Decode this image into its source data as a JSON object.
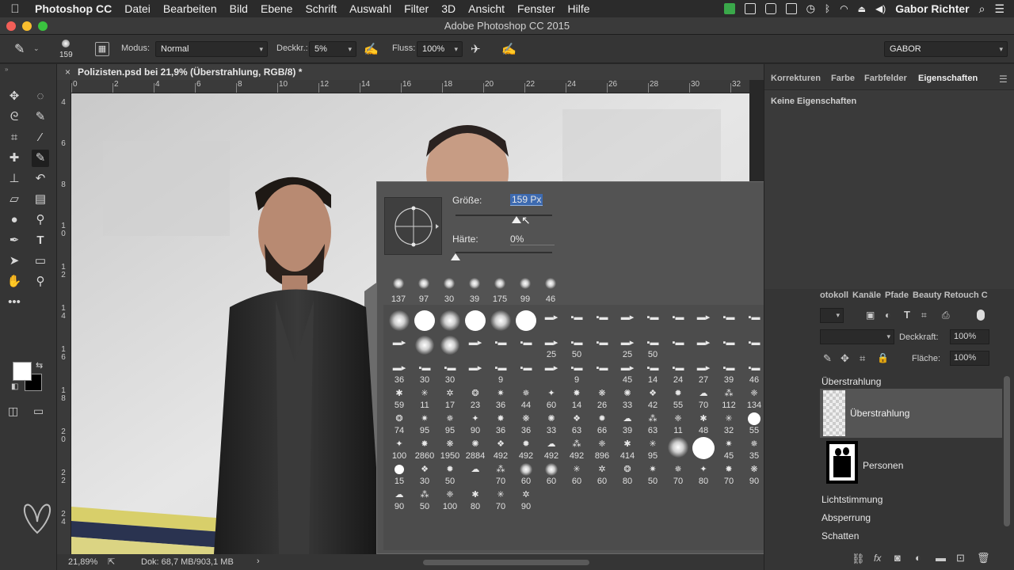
{
  "menubar": {
    "app_name": "Photoshop CC",
    "items": [
      "Datei",
      "Bearbeiten",
      "Bild",
      "Ebene",
      "Schrift",
      "Auswahl",
      "Filter",
      "3D",
      "Ansicht",
      "Fenster",
      "Hilfe"
    ],
    "user": "Gabor Richter"
  },
  "window": {
    "title": "Adobe Photoshop CC 2015"
  },
  "options": {
    "brush_size": "159",
    "mode_label": "Modus:",
    "mode_value": "Normal",
    "opacity_label": "Deckkr.:",
    "opacity_value": "5%",
    "flow_label": "Fluss:",
    "flow_value": "100%",
    "workspace": "GABOR"
  },
  "document": {
    "tab_title": "Polizisten.psd bei 21,9% (Überstrahlung, RGB/8) *",
    "close_glyph": "×"
  },
  "ruler": {
    "h_ticks": [
      "0",
      "2",
      "4",
      "6",
      "8",
      "10",
      "12",
      "14",
      "16",
      "18",
      "20",
      "22",
      "24",
      "26",
      "28",
      "30",
      "32"
    ],
    "v_ticks": [
      "4",
      "6",
      "8",
      "1 0",
      "1 2",
      "1 4",
      "1 6",
      "1 8",
      "2 0",
      "2 2",
      "2 4"
    ]
  },
  "status": {
    "zoom": "21,89%",
    "doc_info": "Dok: 68,7 MB/903,1 MB",
    "arrow": "›"
  },
  "picker": {
    "size_label": "Größe:",
    "size_value": "159 Px",
    "hardness_label": "Härte:",
    "hardness_value": "0%",
    "size_fraction": 0.63,
    "hardness_fraction": 0.0,
    "recent": [
      "137",
      "97",
      "30",
      "39",
      "175",
      "99",
      "46"
    ],
    "rows": [
      [
        "",
        "",
        "",
        "",
        "",
        "",
        "",
        "",
        "",
        "",
        "",
        "",
        "",
        "",
        ""
      ],
      [
        "",
        "",
        "",
        "",
        "",
        "",
        "25",
        "50",
        "",
        "25",
        "50",
        "",
        "",
        "",
        ""
      ],
      [
        "36",
        "30",
        "30",
        "",
        "9",
        "",
        "",
        "9",
        "",
        "45",
        "14",
        "24",
        "27",
        "39",
        "46"
      ],
      [
        "59",
        "11",
        "17",
        "23",
        "36",
        "44",
        "60",
        "14",
        "26",
        "33",
        "42",
        "55",
        "70",
        "112",
        "134"
      ],
      [
        "74",
        "95",
        "95",
        "90",
        "36",
        "36",
        "33",
        "63",
        "66",
        "39",
        "63",
        "11",
        "48",
        "32",
        "55"
      ],
      [
        "100",
        "2860",
        "1950",
        "2884",
        "492",
        "492",
        "492",
        "492",
        "896",
        "414",
        "95",
        "",
        "",
        "45",
        "35"
      ],
      [
        "15",
        "30",
        "50",
        "",
        "70",
        "60",
        "60",
        "60",
        "60",
        "80",
        "50",
        "70",
        "80",
        "70",
        "90"
      ],
      [
        "90",
        "50",
        "100",
        "80",
        "70",
        "90"
      ]
    ]
  },
  "panel_top": {
    "tabs": [
      "Korrekturen",
      "Farbe",
      "Farbfelder",
      "Eigenschaften"
    ],
    "empty_text": "Keine Eigenschaften"
  },
  "panel_layers": {
    "tabs": [
      "otokoll",
      "Kanäle",
      "Pfade",
      "Beauty Retouch C"
    ],
    "opacity_label": "Deckkraft:",
    "opacity_value": "100%",
    "fill_label": "Fläche:",
    "fill_value": "100%",
    "layers": [
      "Überstrahlung",
      "Überstrahlung",
      "Personen",
      "Lichtstimmung",
      "Absperrung",
      "Schatten"
    ]
  },
  "colors": {
    "menubar_bg": "#2b2b2b",
    "panel_bg": "#353535",
    "picker_bg": "#535353",
    "selection_blue": "#3d6ab0",
    "tape_yellow": "#d8cf6a",
    "tape_navy": "#2a3350"
  },
  "icons": [
    "apple-icon",
    "evernote-icon",
    "messages-icon",
    "airplay-icon",
    "time-machine-icon",
    "bluetooth-icon",
    "wifi-icon",
    "eject-icon",
    "volume-icon",
    "search-icon",
    "list-icon",
    "gear-icon",
    "new-preset-icon"
  ]
}
